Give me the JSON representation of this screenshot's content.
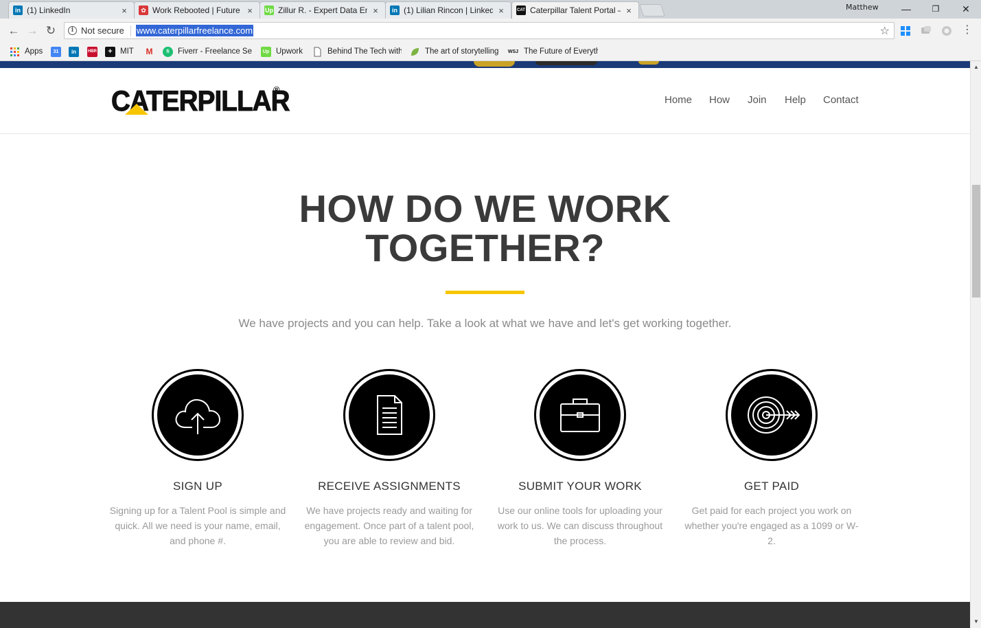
{
  "browser": {
    "tabs": [
      {
        "label": "(1) LinkedIn",
        "icon": "linkedin-icon",
        "color": "#0077b5",
        "glyph": "in"
      },
      {
        "label": "Work Rebooted | Future o",
        "icon": "workrebooted-icon",
        "color": "#d9383a",
        "glyph": "✿"
      },
      {
        "label": "Zillur R. - Expert Data Ent",
        "icon": "upwork-icon",
        "color": "#6fda44",
        "glyph": "Up"
      },
      {
        "label": "(1) Lilian Rincon | LinkedI",
        "icon": "linkedin-icon",
        "color": "#0077b5",
        "glyph": "in"
      },
      {
        "label": "Caterpillar Talent Portal – ",
        "icon": "cat-icon",
        "color": "#111111",
        "glyph": "CAT"
      }
    ],
    "close_glyph": "×",
    "profile_name": "Matthew",
    "window_controls": {
      "minimize": "—",
      "restore": "❐",
      "close": "✕"
    },
    "toolbar": {
      "back": "←",
      "forward": "→",
      "reload": "↻",
      "security_label": "Not secure",
      "info_glyph": "i",
      "url": "www.caterpillarfreelance.com",
      "star": "☆",
      "menu": "⋮"
    },
    "bookmarks": [
      {
        "label": "Apps",
        "icon": "apps-grid-icon",
        "color": "#e0e0e0",
        "glyph": ""
      },
      {
        "label": "",
        "icon": "calendar-icon",
        "color": "#4285f4",
        "glyph": "31"
      },
      {
        "label": "",
        "icon": "linkedin-icon",
        "color": "#0077b5",
        "glyph": "in"
      },
      {
        "label": "",
        "icon": "hbr-icon",
        "color": "#c8102e",
        "glyph": "HBR"
      },
      {
        "label": "MIT",
        "icon": "mit-icon",
        "color": "#111111",
        "glyph": "+"
      },
      {
        "label": "",
        "icon": "gmail-icon",
        "color": "#ffffff",
        "glyph": "M"
      },
      {
        "label": "Fiverr - Freelance Ser",
        "icon": "fiverr-icon",
        "color": "#1dbf73",
        "glyph": "fi"
      },
      {
        "label": "Upwork",
        "icon": "upwork-icon",
        "color": "#6fda44",
        "glyph": "Up"
      },
      {
        "label": "Behind The Tech with",
        "icon": "page-icon",
        "color": "#ffffff",
        "glyph": ""
      },
      {
        "label": "The art of storytelling",
        "icon": "leaf-icon",
        "color": "#7cb342",
        "glyph": ""
      },
      {
        "label": "The Future of Everyth",
        "icon": "wsj-icon",
        "color": "#ffffff",
        "glyph": "WSJ"
      }
    ]
  },
  "site": {
    "logo_text": "CATERPILLAR",
    "logo_reg": "®",
    "brand_yellow": "#f7c600",
    "nav": [
      "Home",
      "How",
      "Join",
      "Help",
      "Contact"
    ],
    "section": {
      "title_line1": "HOW DO WE WORK",
      "title_line2": "TOGETHER?",
      "subtitle": "We have projects and you can help. Take a look at what we have and let's get working together."
    },
    "steps": [
      {
        "title": "SIGN UP",
        "text": "Signing up for a Talent Pool is simple and quick.  All we need is your name, email, and phone #.",
        "icon": "cloud-upload-icon"
      },
      {
        "title": "RECEIVE ASSIGNMENTS",
        "text": "We have projects ready and waiting for engagement.  Once part of a talent pool, you are able to review and bid.",
        "icon": "document-icon"
      },
      {
        "title": "SUBMIT YOUR WORK",
        "text": "Use our online tools for uploading your work to us. We can discuss throughout the process.",
        "icon": "briefcase-icon"
      },
      {
        "title": "GET PAID",
        "text": "Get paid for each project you work on whether you're engaged as a 1099 or W-2.",
        "icon": "target-icon"
      }
    ]
  }
}
